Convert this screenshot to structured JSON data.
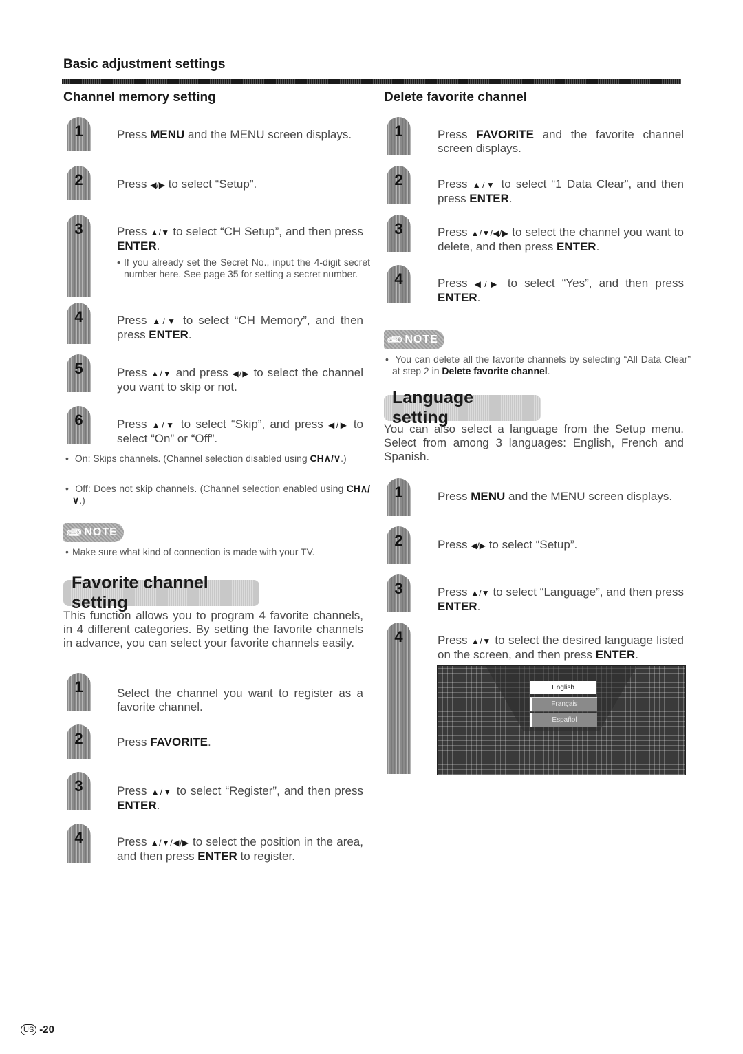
{
  "header": {
    "title": "Basic adjustment settings"
  },
  "channel_memory": {
    "title": "Channel memory setting",
    "steps": [
      {
        "num": "1",
        "pre": "Press ",
        "bold": "MENU",
        "post": " and the MENU screen displays."
      },
      {
        "num": "2",
        "pre": "Press ",
        "arrows": "◀/▶",
        "post": " to select “Setup”."
      },
      {
        "num": "3",
        "pre": "Press ",
        "arrows": "▲/▼",
        "post": " to select “CH Setup”, and then press ",
        "bold": "ENTER",
        "end": ".",
        "bullet": "If you already set the Secret No., input the 4-digit secret number here. See page 35 for setting a secret number."
      },
      {
        "num": "4",
        "pre": "Press ",
        "arrows": "▲/▼",
        "post": " to select “CH Memory”, and then press ",
        "bold": "ENTER",
        "end": "."
      },
      {
        "num": "5",
        "pre": "Press ",
        "arrows": "▲/▼",
        "mid": " and press ",
        "arrows2": "◀/▶",
        "post": " to select the channel you want to skip or not."
      },
      {
        "num": "6",
        "pre": "Press ",
        "arrows": "▲/▼",
        "mid": " to select “Skip”, and press ",
        "arrows2": "◀/▶",
        "post": " to select “On” or “Off”."
      }
    ],
    "bullets": [
      {
        "pre": "On: Skips channels. (Channel selection disabled using ",
        "bold": "CH∧/∨",
        "post": ".)"
      },
      {
        "pre": "Off: Does not skip channels. (Channel selection enabled using ",
        "bold": "CH∧/∨",
        "post": ".)"
      }
    ],
    "note_label": "NOTE",
    "note": "Make sure what kind of connection is made with your TV."
  },
  "favorite_setting": {
    "title": "Favorite channel setting",
    "intro": "This function allows you to program 4 favorite channels, in 4 different categories. By setting the favorite channels in advance, you can select your favorite channels easily.",
    "steps": [
      {
        "num": "1",
        "pre": "Select the channel you want to register as a favorite channel."
      },
      {
        "num": "2",
        "pre": "Press ",
        "bold": "FAVORITE",
        "post": "."
      },
      {
        "num": "3",
        "pre": "Press ",
        "arrows": "▲/▼",
        "post": " to select “Register”, and then press ",
        "bold": "ENTER",
        "end": "."
      },
      {
        "num": "4",
        "pre": "Press ",
        "arrows": "▲/▼/◀/▶",
        "post": " to select the position in the area, and then press ",
        "bold": "ENTER",
        "end": " to register."
      }
    ]
  },
  "delete_favorite": {
    "title": "Delete favorite channel",
    "steps": [
      {
        "num": "1",
        "pre": "Press ",
        "bold": "FAVORITE",
        "post": " and the favorite channel screen displays."
      },
      {
        "num": "2",
        "pre": "Press ",
        "arrows": "▲/▼",
        "post": " to select “1 Data Clear”, and then press ",
        "bold": "ENTER",
        "end": "."
      },
      {
        "num": "3",
        "pre": "Press ",
        "arrows": "▲/▼/◀/▶",
        "post": " to select the channel you want to delete, and then press ",
        "bold": "ENTER",
        "end": "."
      },
      {
        "num": "4",
        "pre": "Press ",
        "arrows": "◀/▶",
        "post": " to select “Yes”, and then press ",
        "bold": "ENTER",
        "end": "."
      }
    ],
    "note_label": "NOTE",
    "note_pre": "You can delete all the favorite channels by selecting “All Data Clear” at step 2 in ",
    "note_bold": "Delete favorite channel",
    "note_post": "."
  },
  "language_setting": {
    "title": "Language setting",
    "intro": "You can also select a language from the Setup menu. Select from among 3 languages: English, French and Spanish.",
    "steps": [
      {
        "num": "1",
        "pre": "Press ",
        "bold": "MENU",
        "post": " and the MENU screen displays."
      },
      {
        "num": "2",
        "pre": "Press ",
        "arrows": "◀/▶",
        "post": " to select “Setup”."
      },
      {
        "num": "3",
        "pre": "Press ",
        "arrows": "▲/▼",
        "post": " to select “Language”, and then press ",
        "bold": "ENTER",
        "end": "."
      },
      {
        "num": "4",
        "pre": "Press ",
        "arrows": "▲/▼",
        "post": " to select the desired language listed on the screen, and then press ",
        "bold": "ENTER",
        "end": "."
      }
    ],
    "screen_options": [
      "English",
      "Français",
      "Español"
    ],
    "screen_selected": "English"
  },
  "footer": {
    "region": "US",
    "page": "-20"
  }
}
